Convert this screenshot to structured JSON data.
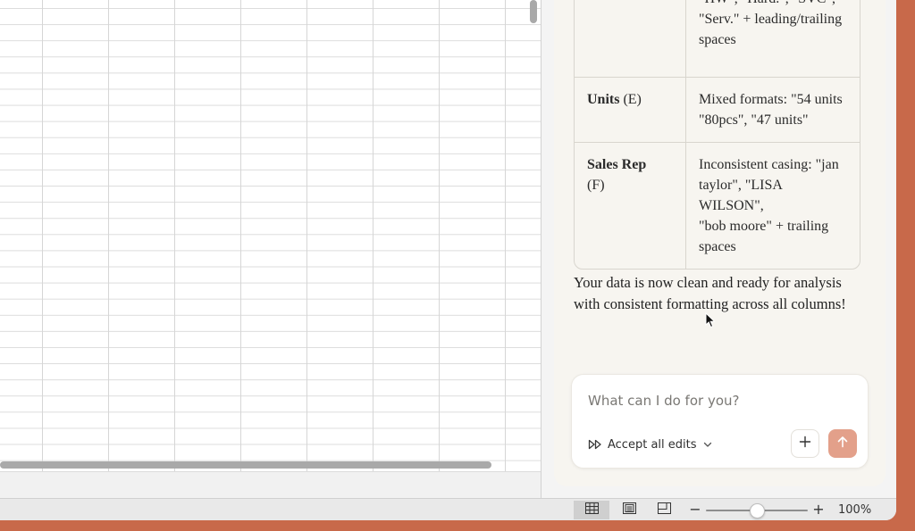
{
  "cleanup_table": {
    "rows": [
      {
        "column": "",
        "letter": "",
        "issue": "casing: \"SW\", \"Soft.\",\n\"HW\", \"Hard.\", \"SVC\",\n\"Serv.\" + leading/trailing\nspaces"
      },
      {
        "column": "Units",
        "letter": "(E)",
        "issue": "Mixed formats: \"54 units\n\"80pcs\", \"47 units\""
      },
      {
        "column": "Sales Rep",
        "letter": "(F)",
        "issue": "Inconsistent casing: \"jan\ntaylor\", \"LISA WILSON\",\n\"bob moore\" + trailing\nspaces"
      }
    ]
  },
  "summary": "Your data is now clean and ready for analysis with consistent formatting across all columns!",
  "composer": {
    "placeholder": "What can I do for you?",
    "accept_all_edits_label": "Accept all edits"
  },
  "status_bar": {
    "zoom_minus": "−",
    "zoom_plus": "+",
    "zoom_label": "100%",
    "zoom_fraction": 0.5
  },
  "icons": {
    "accept": "double-chevron-forward-icon",
    "dropdown": "chevron-down-icon",
    "plus": "plus-icon",
    "send": "arrow-up-icon",
    "normal_view": "grid-view-icon",
    "page_layout": "page-layout-icon",
    "page_break": "page-break-preview-icon"
  },
  "colors": {
    "accent": "#e3a08a",
    "desktop": "#c8694a"
  }
}
